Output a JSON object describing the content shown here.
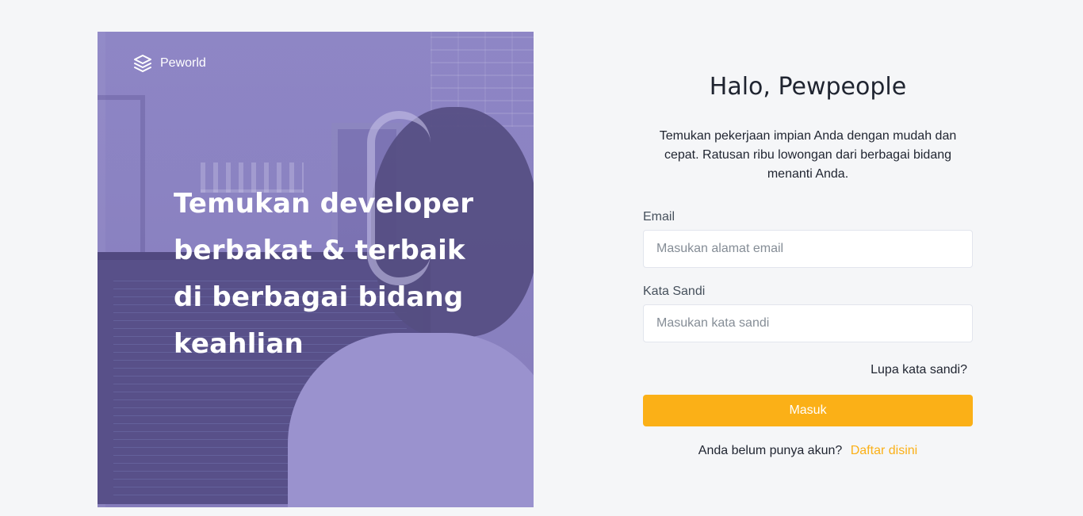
{
  "brand": {
    "name": "Peworld",
    "icon": "layers-icon"
  },
  "hero": {
    "title_lines": [
      "Temukan developer",
      "berbakat & terbaik",
      "di berbagai bidang",
      "keahlian"
    ]
  },
  "login": {
    "greeting": "Halo, Pewpeople",
    "subtitle": "Temukan pekerjaan impian Anda dengan mudah dan cepat. Ratusan ribu lowongan dari berbagai bidang menanti Anda.",
    "email_label": "Email",
    "email_placeholder": "Masukan alamat email",
    "email_value": "",
    "password_label": "Kata Sandi",
    "password_placeholder": "Masukan kata sandi",
    "password_value": "",
    "forgot_label": "Lupa kata sandi?",
    "submit_label": "Masuk",
    "register_prompt": "Anda belum punya akun?",
    "register_link": "Daftar disini"
  },
  "colors": {
    "accent": "#FBB017",
    "hero_overlay": "#867BC4",
    "background": "#F5F6F8",
    "text": "#1F2430"
  }
}
